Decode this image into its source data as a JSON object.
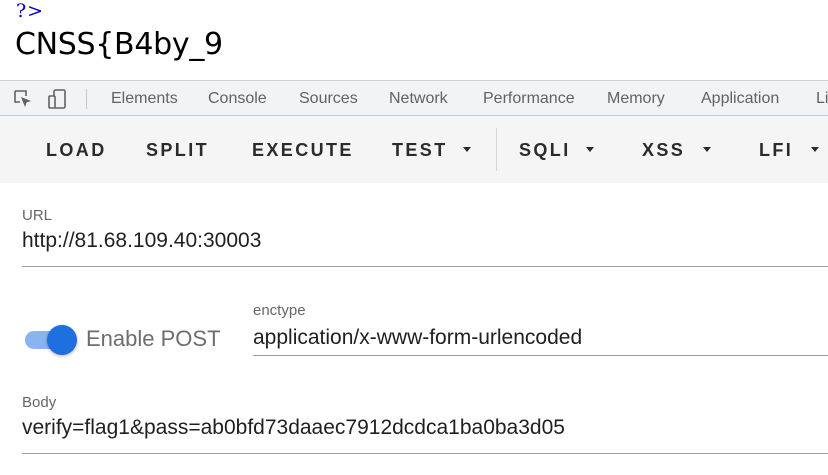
{
  "page": {
    "php_tag": "?>",
    "flag_text": "CNSS{B4by_9"
  },
  "devtools": {
    "inspect_icon": "inspect-element-icon",
    "device_icon": "device-toolbar-icon",
    "tabs": [
      {
        "label": "Elements"
      },
      {
        "label": "Console"
      },
      {
        "label": "Sources"
      },
      {
        "label": "Network"
      },
      {
        "label": "Performance"
      },
      {
        "label": "Memory"
      },
      {
        "label": "Application"
      },
      {
        "label": "Li"
      }
    ]
  },
  "hackbar": {
    "buttons": [
      {
        "label": "LOAD",
        "dropdown": false
      },
      {
        "label": "SPLIT",
        "dropdown": false
      },
      {
        "label": "EXECUTE",
        "dropdown": false
      },
      {
        "label": "TEST",
        "dropdown": true
      },
      {
        "label": "SQLI",
        "dropdown": true
      },
      {
        "label": "XSS",
        "dropdown": true
      },
      {
        "label": "LFI",
        "dropdown": true
      }
    ],
    "accent_color": "#1e6fe0"
  },
  "form": {
    "url_label": "URL",
    "url_value": "http://81.68.109.40:30003",
    "enable_post_label": "Enable POST",
    "enable_post_on": true,
    "enctype_label": "enctype",
    "enctype_value": "application/x-www-form-urlencoded",
    "body_label": "Body",
    "body_value": "verify=flag1&pass=ab0bfd73daaec7912dcdca1ba0ba3d05"
  }
}
